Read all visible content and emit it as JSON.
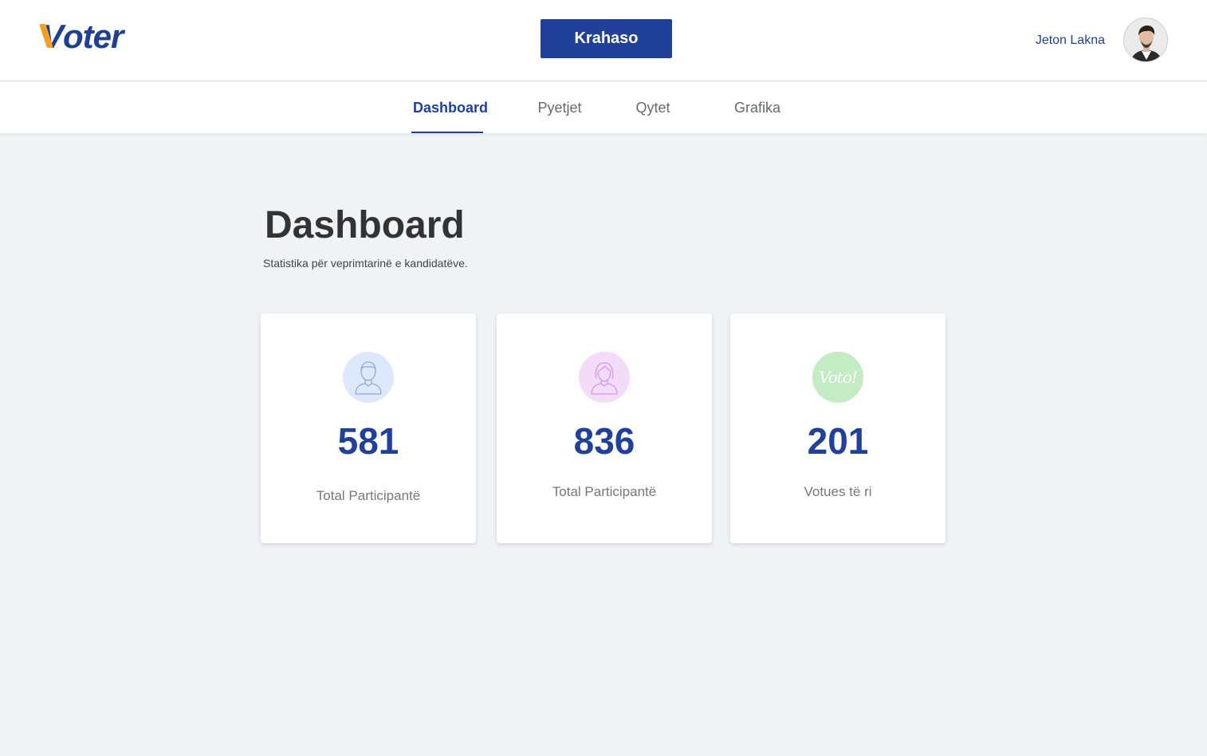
{
  "header": {
    "logo_text": "oter",
    "logo_initial": "V",
    "compare_button": "Krahaso",
    "user_name": "Jeton Lakna"
  },
  "nav": {
    "tabs": [
      {
        "label": "Dashboard",
        "active": true
      },
      {
        "label": "Pyetjet",
        "active": false
      },
      {
        "label": "Qytet",
        "active": false
      },
      {
        "label": "Grafika",
        "active": false
      }
    ]
  },
  "page": {
    "title": "Dashboard",
    "subtitle": "Statistika për veprimtarinë e kandidatëve."
  },
  "cards": [
    {
      "value": "581",
      "label": "Total Participantë",
      "icon": "male-user-icon",
      "icon_bg": "#dde9fb",
      "icon_color": "#8fa9d6"
    },
    {
      "value": "836",
      "label": "Total Participantë",
      "icon": "female-user-icon",
      "icon_bg": "#f3dcf8",
      "icon_color": "#d795e6"
    },
    {
      "value": "201",
      "label": "Votues të ri",
      "icon": "voto-icon",
      "icon_bg": "#c3ecc4",
      "icon_color": "#ffffff",
      "icon_text": "Voto!"
    }
  ],
  "colors": {
    "brand": "#21409a",
    "background": "#eff3f6",
    "logo_accent": "#f0a11e"
  }
}
